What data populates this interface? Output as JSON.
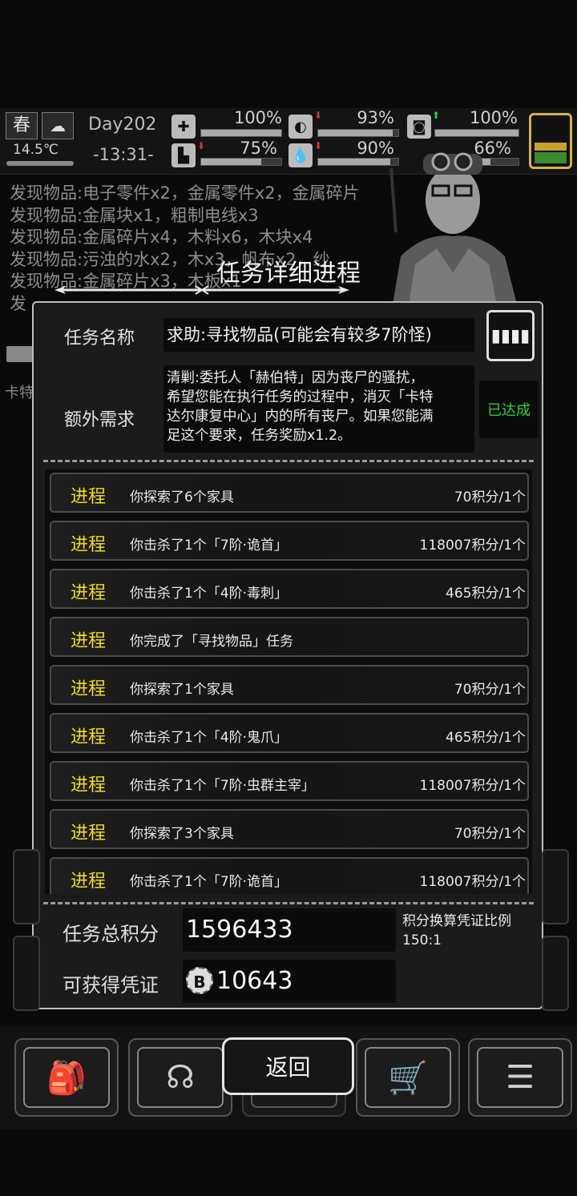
{
  "hud": {
    "season": "春",
    "temperature": "14.5℃",
    "day": "Day202",
    "time": "-13:31-",
    "stats": [
      {
        "name": "health",
        "icon": "medkit-icon",
        "value": "100%",
        "fill": 1.0
      },
      {
        "name": "stomach",
        "icon": "stomach-icon",
        "value": "93%",
        "fill": 0.93,
        "trend": "down"
      },
      {
        "name": "mood",
        "icon": "capsule-icon",
        "value": "100%",
        "fill": 1.0,
        "trend": "up"
      },
      {
        "name": "stamina",
        "icon": "boot-icon",
        "value": "75%",
        "fill": 0.75,
        "trend": "down"
      },
      {
        "name": "water",
        "icon": "water-drop-icon",
        "value": "90%",
        "fill": 0.9,
        "trend": "down"
      },
      {
        "name": "energy",
        "icon": "gear-icon",
        "value": "66%",
        "fill": 0.66
      }
    ]
  },
  "log": [
    "发现物品:电子零件x2，金属零件x2，金属碎片",
    "发现物品:金属块x1，粗制电线x3",
    "发现物品:金属碎片x4，木料x6，木块x4",
    "发现物品:污浊的水x2，木x3，帆布x2，纱",
    "发现物品:金属碎片x3，木板x1",
    "发",
    "卡特"
  ],
  "dialog": {
    "title": "任务详细进程",
    "task_name_label": "任务名称",
    "task_name": "求助:寻找物品(可能会有较多7阶怪)",
    "extra_label": "额外需求",
    "extra_lines": [
      "清剿:委托人「赫伯特」因为丧尸的骚扰，",
      "希望您能在执行任务的过程中，消灭「卡特",
      "达尔康复中心」内的所有丧尸。如果您能满",
      "足这个要求，任务奖励x1.2。"
    ],
    "extra_status": "已达成",
    "progress_rows": [
      {
        "tag": "进程",
        "text": "你探索了6个家具",
        "points": "70积分/1个"
      },
      {
        "tag": "进程",
        "text": "你击杀了1个「7阶·诡首」",
        "points": "118007积分/1个"
      },
      {
        "tag": "进程",
        "text": "你击杀了1个「4阶·毒刺」",
        "points": "465积分/1个"
      },
      {
        "tag": "进程",
        "text": "你完成了「寻找物品」任务",
        "points": ""
      },
      {
        "tag": "进程",
        "text": "你探索了1个家具",
        "points": "70积分/1个"
      },
      {
        "tag": "进程",
        "text": "你击杀了1个「4阶·鬼爪」",
        "points": "465积分/1个"
      },
      {
        "tag": "进程",
        "text": "你击杀了1个「7阶·虫群主宰」",
        "points": "118007积分/1个"
      },
      {
        "tag": "进程",
        "text": "你探索了3个家具",
        "points": "70积分/1个"
      },
      {
        "tag": "进程",
        "text": "你击杀了1个「7阶·诡首」",
        "points": "118007积分/1个"
      }
    ],
    "total_label": "任务总积分",
    "total_value": "1596433",
    "ratio_label": "积分换算凭证比例",
    "ratio_value": "150:1",
    "voucher_label": "可获得凭证",
    "voucher_value": "10643"
  },
  "buttons": {
    "back": "返回"
  }
}
